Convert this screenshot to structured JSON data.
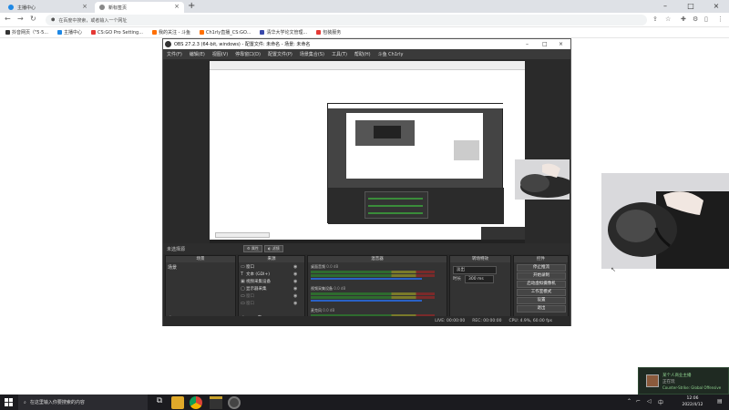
{
  "browser": {
    "tabs": [
      {
        "label": "主播中心",
        "favicon_color": "#1e88e5"
      },
      {
        "label": "新标签页",
        "favicon_color": "#888888"
      }
    ],
    "new_tab": "+",
    "address_placeholder": "在百度中搜索，或者输入一个网址",
    "bookmarks": [
      {
        "label": "抖音网页（\"5·5...",
        "color": "#333333"
      },
      {
        "label": "主播中心",
        "color": "#1e88e5"
      },
      {
        "label": "CS:GO Pro Setting...",
        "color": "#e53935"
      },
      {
        "label": "我的关注 - 斗鱼",
        "color": "#ff6f00"
      },
      {
        "label": "Ch1rly直播_CS:GO...",
        "color": "#ff6f00"
      },
      {
        "label": "清华大学论文管理...",
        "color": "#3949ab"
      },
      {
        "label": "包装服务",
        "color": "#e53935"
      }
    ]
  },
  "obs": {
    "title": "OBS 27.2.3 (64-bit, windows) - 配置文件: 未命名 - 场景: 未命名",
    "menu": [
      "文件(F)",
      "编辑(E)",
      "视图(V)",
      "停靠窗口(D)",
      "配置文件(P)",
      "场景集合(S)",
      "工具(T)",
      "帮助(H)",
      "斗鱼 Ch1rly"
    ],
    "no_source_selected": "未选择源",
    "properties_btn": "属性",
    "filters_btn": "滤镜",
    "docks": {
      "scenes": "场景",
      "sources": "来源",
      "mixer": "混音器",
      "transitions": "转场特效",
      "controls": "控件"
    },
    "scene_items": [
      "场景"
    ],
    "sources": [
      {
        "label": "窗口",
        "icon": "window-icon"
      },
      {
        "label": "文本 (GDI+)",
        "icon": "text-icon"
      },
      {
        "label": "视频采集设备",
        "icon": "camera-icon"
      },
      {
        "label": "显示器采集",
        "icon": "monitor-icon"
      },
      {
        "label": "窗口",
        "icon": "window-icon"
      },
      {
        "label": "窗口",
        "icon": "window-icon"
      }
    ],
    "mixer": [
      {
        "label": "桌面音频",
        "db": "0.0 dB"
      },
      {
        "label": "视频采集设备",
        "db": "0.0 dB"
      },
      {
        "label": "麦克风",
        "db": "0.0 dB"
      }
    ],
    "transition": {
      "selected": "淡出",
      "duration_label": "时长",
      "duration_value": "300 ms"
    },
    "controls": [
      "停止推流",
      "开始录制",
      "启动虚拟摄像机",
      "工作室模式",
      "设置",
      "退出"
    ],
    "status": {
      "live_label": "LIVE: 00:00:00",
      "rec_label": "REC: 00:00:00",
      "cpu_label": "CPU: 4.9%, 60.00 fps"
    }
  },
  "notification": {
    "line1": "某个人商业主播",
    "line2": "正在玩",
    "line3": "Counter-Strike: Global Offensive"
  },
  "taskbar": {
    "search_placeholder": "在这里输入你要搜索的内容",
    "time": "12:06",
    "date": "2022/4/12"
  }
}
